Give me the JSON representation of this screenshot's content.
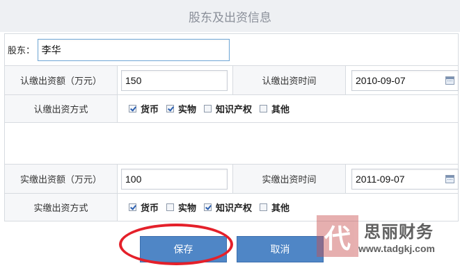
{
  "header": {
    "title": "股东及出资信息"
  },
  "shareholder": {
    "label": "股东：",
    "value": "李华"
  },
  "subscribed": {
    "amount_label": "认缴出资额（万元）",
    "amount_value": "150",
    "time_label": "认缴出资时间",
    "time_value": "2010-09-07",
    "method_label": "认缴出资方式",
    "methods": [
      {
        "label": "货币",
        "checked": true
      },
      {
        "label": "实物",
        "checked": true
      },
      {
        "label": "知识产权",
        "checked": false
      },
      {
        "label": "其他",
        "checked": false
      }
    ]
  },
  "paid": {
    "amount_label": "实缴出资额（万元）",
    "amount_value": "100",
    "time_label": "实缴出资时间",
    "time_value": "2011-09-07",
    "method_label": "实缴出资方式",
    "methods": [
      {
        "label": "货币",
        "checked": true
      },
      {
        "label": "实物",
        "checked": false
      },
      {
        "label": "知识产权",
        "checked": true
      },
      {
        "label": "其他",
        "checked": false
      }
    ]
  },
  "buttons": {
    "save": "保存",
    "cancel": "取消"
  },
  "watermark": {
    "logo_char": "代",
    "name": "思丽财务",
    "url": "www.tadgkj.com"
  },
  "icons": {
    "date_picker": "calendar-icon",
    "checkbox": "checkbox"
  },
  "colors": {
    "button": "#4f86c6",
    "highlight_ring": "#e4202a",
    "header_bg": "#eef0f3"
  }
}
